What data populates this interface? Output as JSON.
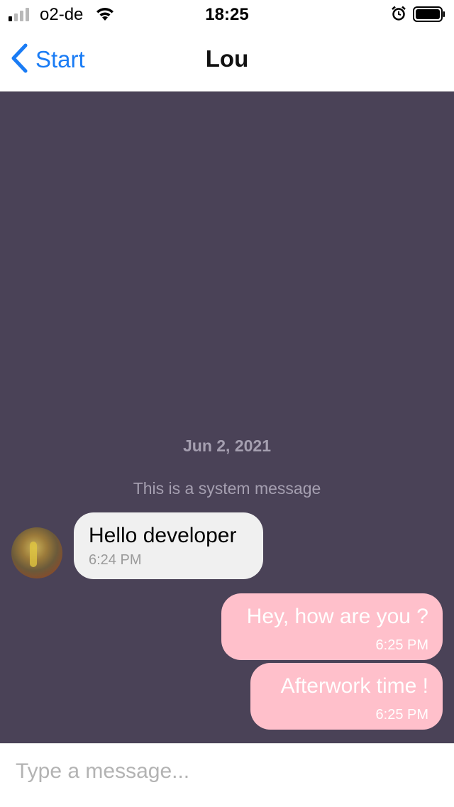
{
  "status_bar": {
    "carrier": "o2-de",
    "time": "18:25",
    "signal_bars_filled": 1,
    "signal_bars_total": 4
  },
  "nav": {
    "back_label": "Start",
    "title": "Lou"
  },
  "chat": {
    "date_separator": "Jun 2, 2021",
    "system_message": "This is a system message",
    "messages": [
      {
        "direction": "incoming",
        "text": "Hello developer",
        "time": "6:24 PM"
      },
      {
        "direction": "outgoing",
        "text": "Hey, how are you ?",
        "time": "6:25 PM"
      },
      {
        "direction": "outgoing",
        "text": "Afterwork time !",
        "time": "6:25 PM"
      }
    ]
  },
  "composer": {
    "placeholder": "Type a message...",
    "value": ""
  },
  "colors": {
    "chat_background": "#4a4257",
    "incoming_bubble": "#f0f0f0",
    "outgoing_bubble": "#ffc0cb",
    "accent": "#1a7cf5"
  },
  "icons": [
    "cellular-signal-icon",
    "wifi-icon",
    "alarm-icon",
    "battery-icon",
    "chevron-left-icon"
  ]
}
